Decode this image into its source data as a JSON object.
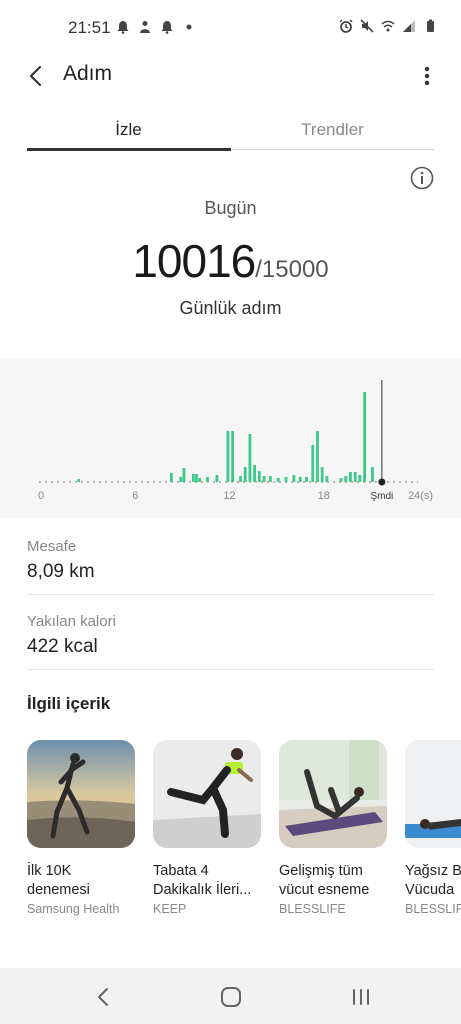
{
  "status_bar": {
    "time": "21:51",
    "left_icons": [
      "alarm-bell-icon",
      "person-icon",
      "bell-icon",
      "dot-icon"
    ],
    "right_icons": [
      "alarm-clock-icon",
      "mute-icon",
      "wifi-icon",
      "signal-icon",
      "battery-icon"
    ]
  },
  "app_bar": {
    "title": "Adım"
  },
  "tabs": [
    {
      "label": "İzle",
      "selected": true
    },
    {
      "label": "Trendler",
      "selected": false
    }
  ],
  "summary": {
    "today_label": "Bugün",
    "steps": "10016",
    "goal": "/15000",
    "caption": "Günlük adım"
  },
  "chart_data": {
    "type": "bar",
    "x_labels": [
      "0",
      "6",
      "12",
      "18",
      "Şmdi",
      "24(s)"
    ],
    "x_range": [
      0,
      24
    ],
    "now_hour": 21.7,
    "color": "#3ec98a",
    "bars": [
      {
        "x": 2.4,
        "h": 0.03
      },
      {
        "x": 8.3,
        "h": 0.09
      },
      {
        "x": 8.9,
        "h": 0.05
      },
      {
        "x": 9.1,
        "h": 0.14
      },
      {
        "x": 9.7,
        "h": 0.08
      },
      {
        "x": 9.9,
        "h": 0.08
      },
      {
        "x": 10.1,
        "h": 0.04
      },
      {
        "x": 10.6,
        "h": 0.05
      },
      {
        "x": 11.2,
        "h": 0.07
      },
      {
        "x": 11.9,
        "h": 0.51
      },
      {
        "x": 12.2,
        "h": 0.51
      },
      {
        "x": 12.7,
        "h": 0.06
      },
      {
        "x": 13.0,
        "h": 0.15
      },
      {
        "x": 13.3,
        "h": 0.48
      },
      {
        "x": 13.6,
        "h": 0.17
      },
      {
        "x": 13.9,
        "h": 0.11
      },
      {
        "x": 14.2,
        "h": 0.06
      },
      {
        "x": 14.6,
        "h": 0.06
      },
      {
        "x": 15.1,
        "h": 0.04
      },
      {
        "x": 15.6,
        "h": 0.05
      },
      {
        "x": 16.1,
        "h": 0.07
      },
      {
        "x": 16.5,
        "h": 0.05
      },
      {
        "x": 16.9,
        "h": 0.05
      },
      {
        "x": 17.3,
        "h": 0.37
      },
      {
        "x": 17.6,
        "h": 0.51
      },
      {
        "x": 17.9,
        "h": 0.15
      },
      {
        "x": 18.2,
        "h": 0.06
      },
      {
        "x": 19.1,
        "h": 0.04
      },
      {
        "x": 19.4,
        "h": 0.06
      },
      {
        "x": 19.7,
        "h": 0.1
      },
      {
        "x": 20.0,
        "h": 0.1
      },
      {
        "x": 20.3,
        "h": 0.07
      },
      {
        "x": 20.6,
        "h": 0.9
      },
      {
        "x": 21.1,
        "h": 0.15
      }
    ]
  },
  "stats": [
    {
      "label": "Mesafe",
      "value": "8,09 km"
    },
    {
      "label": "Yakılan kalori",
      "value": "422 kcal"
    }
  ],
  "related": {
    "title": "İlgili içerik",
    "cards": [
      {
        "title_line1": "İlk 10K",
        "title_line2": "denemesi",
        "source": "Samsung Health"
      },
      {
        "title_line1": "Tabata 4",
        "title_line2": "Dakikalık İleri...",
        "source": "KEEP"
      },
      {
        "title_line1": "Gelişmiş tüm",
        "title_line2": "vücut esneme",
        "source": "BLESSLIFE"
      },
      {
        "title_line1": "Yağsız B",
        "title_line2": "Vücuda",
        "source": "BLESSLIFE"
      }
    ]
  },
  "nav_bar": {
    "icons": [
      "back-nav-icon",
      "home-nav-icon",
      "recents-nav-icon"
    ]
  }
}
